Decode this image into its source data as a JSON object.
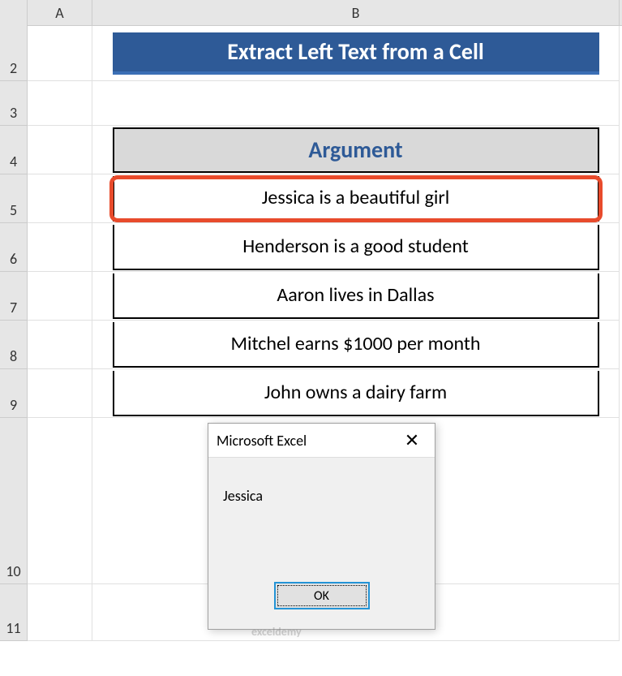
{
  "columns": {
    "a": "A",
    "b": "B"
  },
  "rows": {
    "r2": "2",
    "r3": "3",
    "r4": "4",
    "r5": "5",
    "r6": "6",
    "r7": "7",
    "r8": "8",
    "r9": "9",
    "r10": "10",
    "r11": "11"
  },
  "title": "Extract Left Text from a Cell",
  "table": {
    "header": "Argument",
    "rows": [
      "Jessica is a beautiful girl",
      "Henderson is a good student",
      "Aaron lives in Dallas",
      "Mitchel earns $1000 per month",
      "John owns a dairy farm"
    ]
  },
  "msgbox": {
    "title": "Microsoft Excel",
    "body": "Jessica",
    "ok": "OK"
  },
  "watermark": "exceldemy"
}
